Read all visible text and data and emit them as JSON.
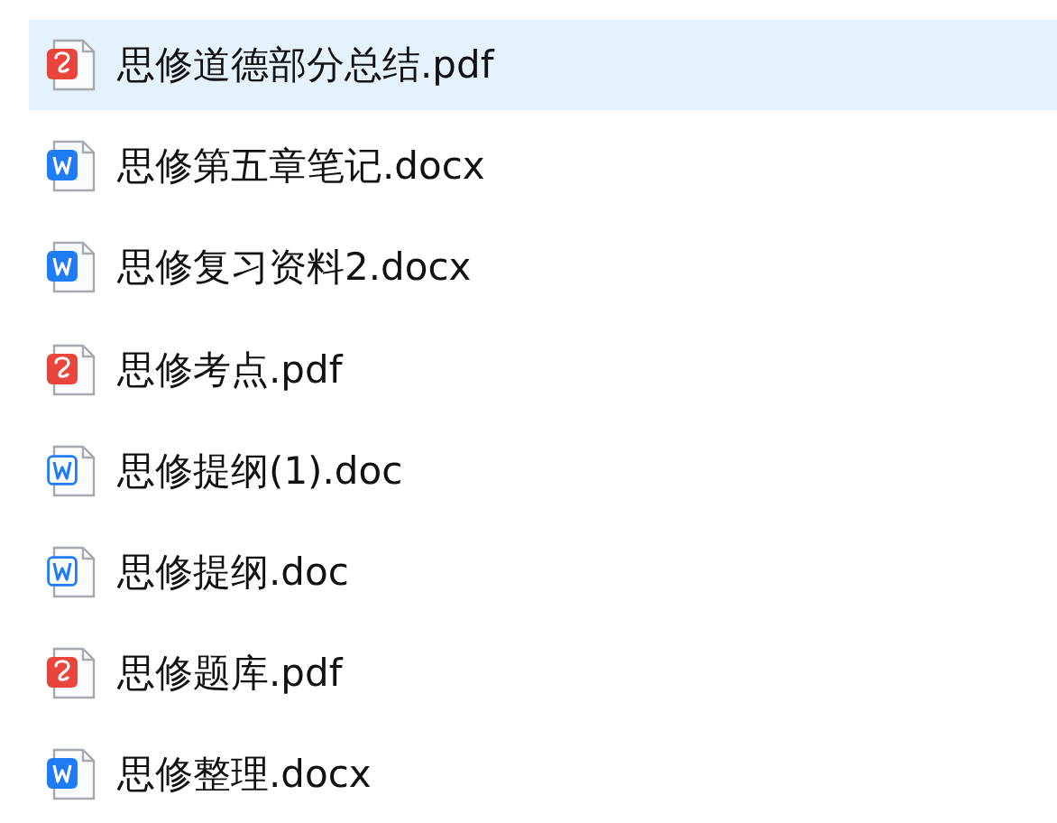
{
  "files": [
    {
      "name": "思修道德部分总结.pdf",
      "kind": "pdf",
      "selected": true
    },
    {
      "name": "思修第五章笔记.docx",
      "kind": "docx",
      "selected": false
    },
    {
      "name": "思修复习资料2.docx",
      "kind": "docx",
      "selected": false
    },
    {
      "name": "思修考点.pdf",
      "kind": "pdf",
      "selected": false
    },
    {
      "name": "思修提纲(1).doc",
      "kind": "doc",
      "selected": false
    },
    {
      "name": "思修提纲.doc",
      "kind": "doc",
      "selected": false
    },
    {
      "name": "思修题库.pdf",
      "kind": "pdf",
      "selected": false
    },
    {
      "name": "思修整理.docx",
      "kind": "docx",
      "selected": false
    }
  ]
}
